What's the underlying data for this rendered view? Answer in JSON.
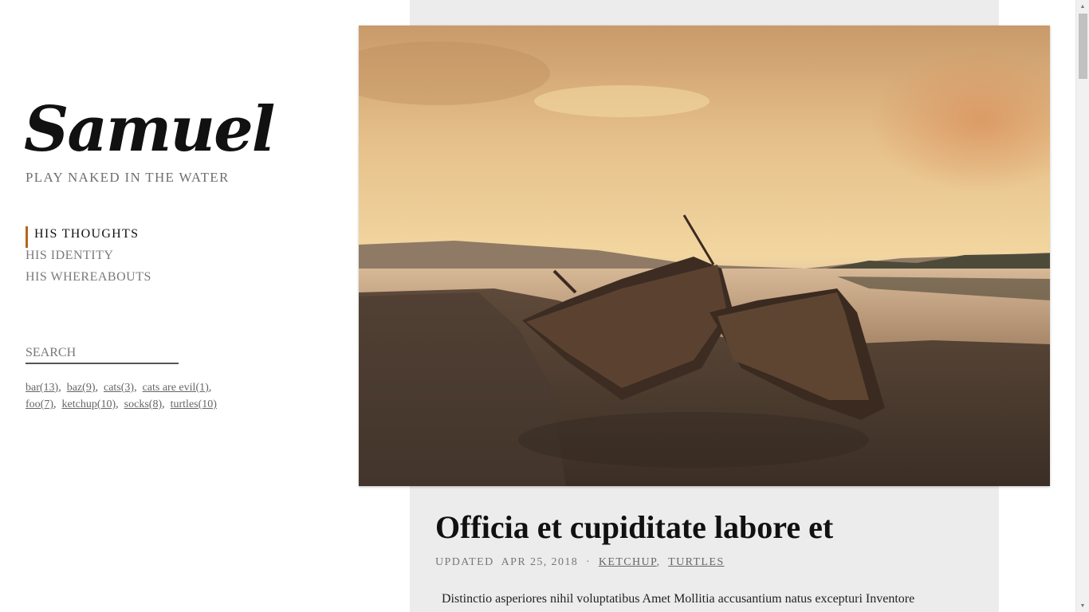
{
  "site": {
    "title": "Samuel",
    "tagline": "Play naked in the water"
  },
  "nav": {
    "items": [
      {
        "label": "His Thoughts",
        "active": true
      },
      {
        "label": "His Identity",
        "active": false
      },
      {
        "label": "His Whereabouts",
        "active": false
      }
    ]
  },
  "search": {
    "label": "Search"
  },
  "tags": [
    {
      "name": "bar",
      "count": "(13)"
    },
    {
      "name": "baz",
      "count": "(9)"
    },
    {
      "name": "cats",
      "count": "(3)"
    },
    {
      "name": "cats are evil",
      "count": "(1)"
    },
    {
      "name": "foo",
      "count": "(7)"
    },
    {
      "name": "ketchup",
      "count": "(10)"
    },
    {
      "name": "socks",
      "count": "(8)"
    },
    {
      "name": "turtles",
      "count": "(10)"
    }
  ],
  "post": {
    "title": "Officia et cupiditate labore et",
    "updated_label": "Updated",
    "date": "Apr 25, 2018",
    "separator": "·",
    "tags": [
      "ketchup",
      "turtles"
    ],
    "excerpt": "Distinctio asperiores nihil voluptatibus Amet Mollitia accusantium natus excepturi Inventore"
  },
  "colors": {
    "accent": "#b5651d",
    "content_bg": "#ececec"
  }
}
